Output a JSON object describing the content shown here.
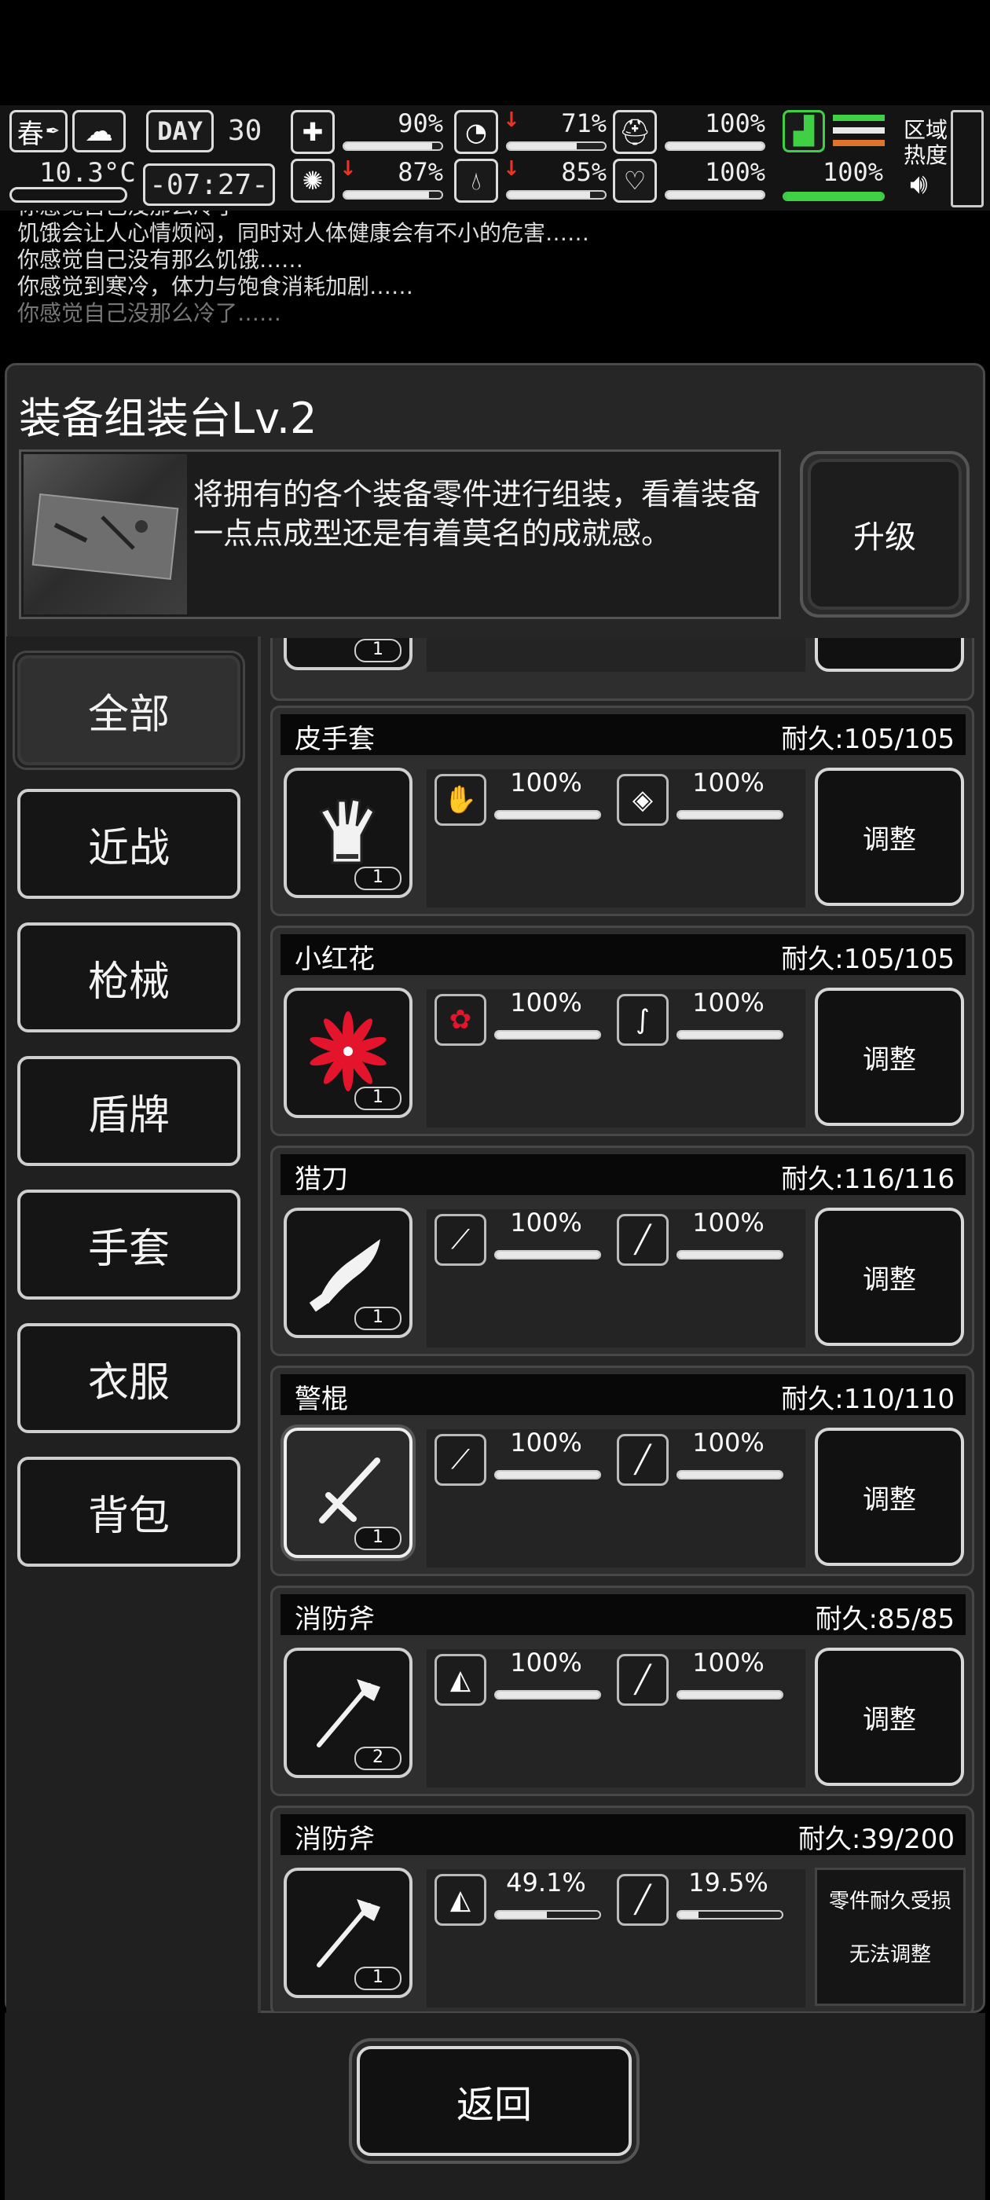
{
  "status": {
    "season": "春",
    "temperature": "10.3°C",
    "day_label": "DAY",
    "day_value": "30",
    "time": "-07:27-",
    "stats": [
      {
        "icon": "medkit-icon",
        "value": "90%",
        "fill": 0.9,
        "arrow": false
      },
      {
        "icon": "stomach-icon",
        "value": "71%",
        "fill": 0.71,
        "arrow": true
      },
      {
        "icon": "helmet-icon",
        "value": "100%",
        "fill": 1.0,
        "arrow": false
      },
      {
        "icon": "brain-icon",
        "value": "87%",
        "fill": 0.87,
        "arrow": true
      },
      {
        "icon": "water-drop-icon",
        "value": "85%",
        "fill": 0.85,
        "arrow": true
      },
      {
        "icon": "heart-icon",
        "value": "100%",
        "fill": 1.0,
        "arrow": false
      }
    ],
    "stamina": {
      "value": "100%",
      "fill": 1.0,
      "color": "#3fd046"
    },
    "region_heat_label": "区域\n热度"
  },
  "log": [
    {
      "text": "你感觉自己没那么冷了",
      "dim": false
    },
    {
      "text": "饥饿会让人心情烦闷，同时对人体健康会有不小的危害……",
      "dim": false
    },
    {
      "text": "你感觉自己没有那么饥饿……",
      "dim": false
    },
    {
      "text": "你感觉到寒冷，体力与饱食消耗加剧……",
      "dim": false
    },
    {
      "text": "你感觉自己没那么冷了……",
      "dim": true
    }
  ],
  "panel": {
    "title": "装备组装台Lv.2",
    "description": "将拥有的各个装备零件进行组装，看着装备一点点成型还是有着莫名的成就感。",
    "upgrade_label": "升级"
  },
  "categories": [
    {
      "label": "全部",
      "active": true
    },
    {
      "label": "近战",
      "active": false
    },
    {
      "label": "枪械",
      "active": false
    },
    {
      "label": "盾牌",
      "active": false
    },
    {
      "label": "手套",
      "active": false
    },
    {
      "label": "衣服",
      "active": false
    },
    {
      "label": "背包",
      "active": false
    }
  ],
  "items": [
    {
      "name": "皮手套",
      "durability": "耐久:105/105",
      "count": "1",
      "icon": "leather-glove-icon",
      "parts": [
        {
          "icon": "glove-part-icon",
          "pct": "100%",
          "fill": 1.0
        },
        {
          "icon": "leather-part-icon",
          "pct": "100%",
          "fill": 1.0
        }
      ],
      "action": "调整",
      "adjustable": true,
      "selected": false
    },
    {
      "name": "小红花",
      "durability": "耐久:105/105",
      "count": "1",
      "icon": "red-flower-icon",
      "parts": [
        {
          "icon": "flower-part-icon",
          "pct": "100%",
          "fill": 1.0
        },
        {
          "icon": "stem-part-icon",
          "pct": "100%",
          "fill": 1.0
        }
      ],
      "action": "调整",
      "adjustable": true,
      "selected": false
    },
    {
      "name": "猎刀",
      "durability": "耐久:116/116",
      "count": "1",
      "icon": "kukri-knife-icon",
      "parts": [
        {
          "icon": "blade-part-icon",
          "pct": "100%",
          "fill": 1.0
        },
        {
          "icon": "handle-part-icon",
          "pct": "100%",
          "fill": 1.0
        }
      ],
      "action": "调整",
      "adjustable": true,
      "selected": false
    },
    {
      "name": "警棍",
      "durability": "耐久:110/110",
      "count": "1",
      "icon": "baton-icon",
      "parts": [
        {
          "icon": "baton-part-icon",
          "pct": "100%",
          "fill": 1.0
        },
        {
          "icon": "handle-part-icon",
          "pct": "100%",
          "fill": 1.0
        }
      ],
      "action": "调整",
      "adjustable": true,
      "selected": true
    },
    {
      "name": "消防斧",
      "durability": "耐久:85/85",
      "count": "2",
      "icon": "fire-axe-icon",
      "parts": [
        {
          "icon": "axe-head-part-icon",
          "pct": "100%",
          "fill": 1.0
        },
        {
          "icon": "handle-part-icon",
          "pct": "100%",
          "fill": 1.0
        }
      ],
      "action": "调整",
      "adjustable": true,
      "selected": false
    },
    {
      "name": "消防斧",
      "durability": "耐久:39/200",
      "count": "1",
      "icon": "fire-axe-icon",
      "parts": [
        {
          "icon": "axe-head-part-icon",
          "pct": "49.1%",
          "fill": 0.491
        },
        {
          "icon": "handle-part-icon",
          "pct": "19.5%",
          "fill": 0.195
        }
      ],
      "action": "零件耐久受损\n无法调整",
      "action_line1": "零件耐久受损",
      "action_line2": "无法调整",
      "adjustable": false,
      "selected": false
    }
  ],
  "back_label": "返回"
}
